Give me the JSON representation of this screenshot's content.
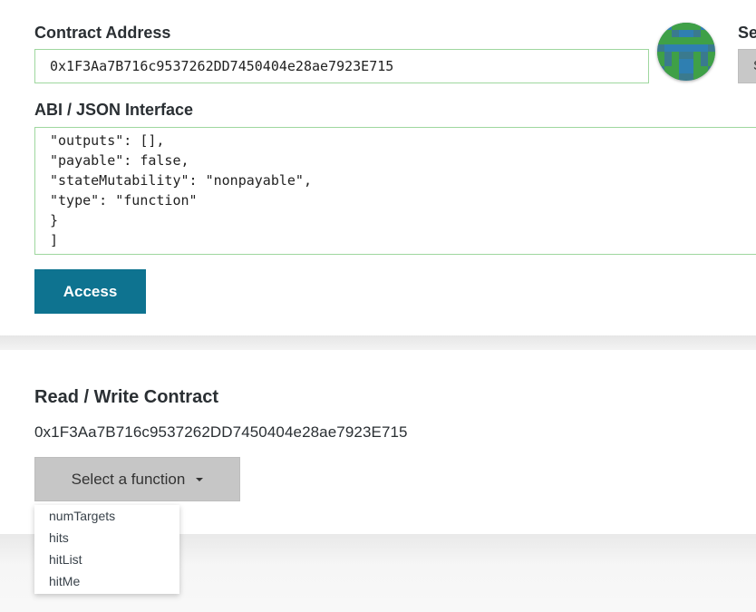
{
  "contract_address": {
    "label": "Contract Address",
    "value": "0x1F3Aa7B716c9537262DD7450404e28ae7923E715"
  },
  "select_existing": {
    "label": "Se",
    "button_text": "S"
  },
  "abi": {
    "label": "ABI / JSON Interface",
    "lines": [
      "\"outputs\": [],",
      "\"payable\": false,",
      "\"stateMutability\": \"nonpayable\",",
      "\"type\": \"function\"",
      "}",
      "]"
    ]
  },
  "access_button": "Access",
  "read_write": {
    "title": "Read / Write Contract",
    "address": "0x1F3Aa7B716c9537262DD7450404e28ae7923E715",
    "select_label": "Select a function",
    "functions": [
      "numTargets",
      "hits",
      "hitList",
      "hitMe"
    ]
  },
  "colors": {
    "accent_button": "#0e7390",
    "valid_border": "#9fd79f",
    "dropdown_button": "#c6c6c6"
  },
  "icons": {
    "avatar": "identicon-avatar",
    "dropdown": "caret-down-icon"
  }
}
